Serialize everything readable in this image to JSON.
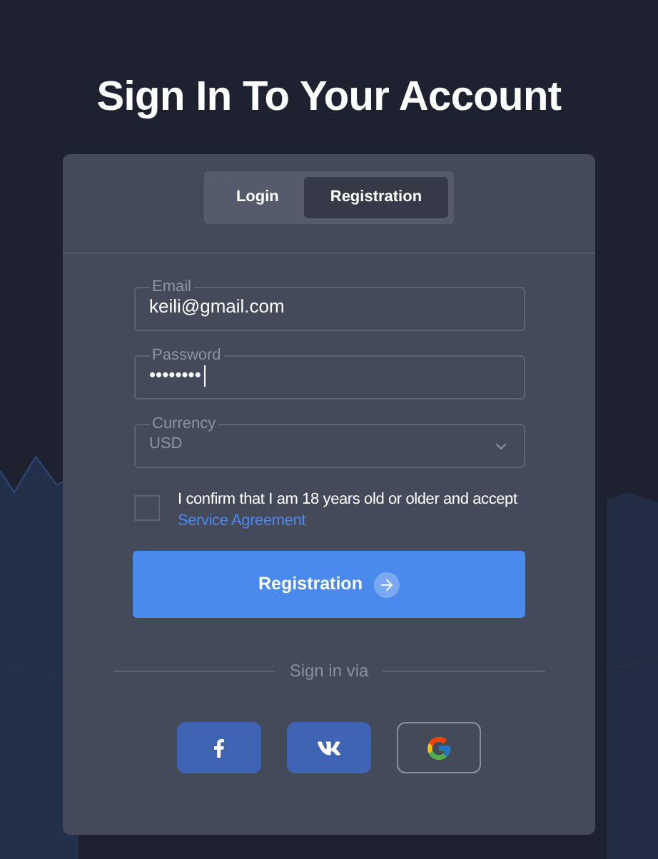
{
  "title": "Sign In To Your Account",
  "tabs": [
    {
      "label": "Login",
      "selected": false
    },
    {
      "label": "Registration",
      "selected": true
    }
  ],
  "fields": [
    {
      "kind": "text",
      "label": "Email",
      "value": "keili@gmail.com",
      "focused": false
    },
    {
      "kind": "text",
      "label": "Password",
      "value": "••••••••",
      "focused": true
    },
    {
      "kind": "select",
      "label": "Currency",
      "value": "USD",
      "focused": false,
      "disabled": true
    }
  ],
  "agreement": {
    "text": "I confirm that I am 18 years old or older and accept",
    "link": "Service Agreement",
    "checked": false
  },
  "submit": {
    "label": "Registration"
  },
  "divider_text": "Sign in via",
  "social": [
    {
      "kind": "facebook"
    },
    {
      "kind": "vk"
    },
    {
      "kind": "google"
    }
  ]
}
